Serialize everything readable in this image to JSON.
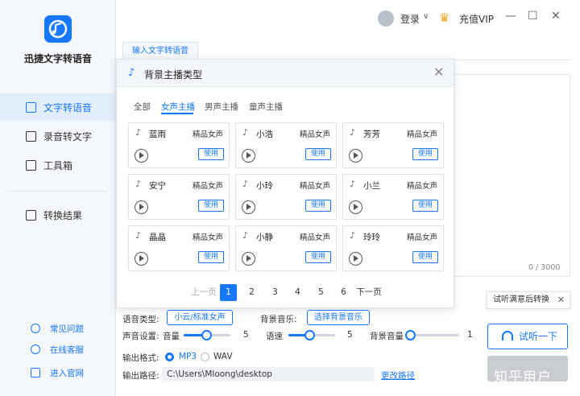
{
  "app": {
    "name": "迅捷文字转语音"
  },
  "sidebar": {
    "items": [
      {
        "label": "文字转语音",
        "active": true
      },
      {
        "label": "录音转文字"
      },
      {
        "label": "工具箱"
      },
      {
        "label": "转换结果"
      }
    ],
    "footer": [
      {
        "label": "常见问题"
      },
      {
        "label": "在线客服"
      },
      {
        "label": "进入官网"
      }
    ]
  },
  "topbar": {
    "login": "登录",
    "vip": "充值VIP"
  },
  "main": {
    "tab": "输入文字转语音",
    "char_count": "0 / 3000"
  },
  "dialog": {
    "title": "背景主播类型",
    "categories": [
      "全部",
      "女声主播",
      "男声主播",
      "童声主播"
    ],
    "active_category": "女声主播",
    "voices": [
      {
        "name": "蓝雨",
        "tag": "精品女声",
        "use": "使用"
      },
      {
        "name": "小浩",
        "tag": "精品女声",
        "use": "使用"
      },
      {
        "name": "芳芳",
        "tag": "精品女声",
        "use": "使用"
      },
      {
        "name": "安宁",
        "tag": "精品女声",
        "use": "使用"
      },
      {
        "name": "小玲",
        "tag": "精品女声",
        "use": "使用"
      },
      {
        "name": "小兰",
        "tag": "精品女声",
        "use": "使用"
      },
      {
        "name": "晶晶",
        "tag": "精品女声",
        "use": "使用"
      },
      {
        "name": "小静",
        "tag": "精品女声",
        "use": "使用"
      },
      {
        "name": "玲玲",
        "tag": "精品女声",
        "use": "使用"
      }
    ],
    "pagination": {
      "prev": "上一页",
      "next": "下一页",
      "pages": [
        "1",
        "2",
        "3",
        "4",
        "5",
        "6"
      ],
      "current": "1"
    }
  },
  "settings": {
    "voice_type_label": "语音类型:",
    "voice_type_value": "小云/标准女声",
    "bg_music_label": "背景音乐:",
    "bg_music_button": "选择背景音乐",
    "sound_label": "声音设置:",
    "volume_label": "音量",
    "volume_value": "5",
    "speed_label": "语速",
    "speed_value": "5",
    "bg_volume_label": "背景音量",
    "bg_volume_value": "1",
    "format_label": "输出格式:",
    "formats": [
      "MP3",
      "WAV"
    ],
    "selected_format": "MP3",
    "path_label": "输出路径:",
    "path_value": "C:\\Users\\Mloong\\desktop",
    "change_path": "更改路径"
  },
  "actions": {
    "tooltip": "试听满意后转换",
    "try_listen": "试听一下"
  },
  "watermark": "知乎用户",
  "colors": {
    "accent": "#1677ff",
    "sidebar_bg": "#f4f7fb"
  }
}
